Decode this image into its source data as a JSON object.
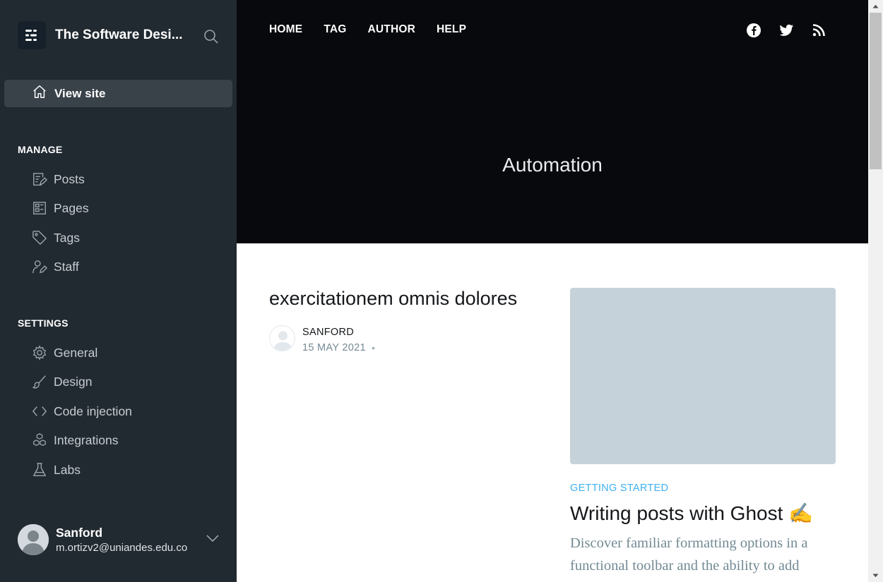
{
  "sidebar": {
    "site_title": "The Software Desi...",
    "view_site_label": "View site",
    "manage_heading": "MANAGE",
    "manage_items": [
      {
        "label": "Posts",
        "icon": "posts-icon"
      },
      {
        "label": "Pages",
        "icon": "pages-icon"
      },
      {
        "label": "Tags",
        "icon": "tag-icon"
      },
      {
        "label": "Staff",
        "icon": "staff-icon"
      }
    ],
    "settings_heading": "SETTINGS",
    "settings_items": [
      {
        "label": "General",
        "icon": "gear-icon"
      },
      {
        "label": "Design",
        "icon": "brush-icon"
      },
      {
        "label": "Code injection",
        "icon": "code-icon"
      },
      {
        "label": "Integrations",
        "icon": "integrations-icon"
      },
      {
        "label": "Labs",
        "icon": "flask-icon"
      }
    ],
    "user": {
      "name": "Sanford",
      "email": "m.ortizv2@uniandes.edu.co"
    }
  },
  "site": {
    "nav": [
      "HOME",
      "TAG",
      "AUTHOR",
      "HELP"
    ],
    "social_icons": [
      "facebook-icon",
      "twitter-icon",
      "rss-icon"
    ],
    "hero_title": "Automation"
  },
  "post": {
    "title": "exercitationem omnis dolores",
    "author": "SANFORD",
    "date": "15 MAY 2021",
    "separator": "•"
  },
  "card": {
    "tag": "GETTING STARTED",
    "title": "Writing posts with Ghost ✍️",
    "excerpt": "Discover familiar formatting options in a functional toolbar and the ability to add"
  },
  "colors": {
    "sidebar_bg": "#222a31",
    "hero_bg": "#08090c",
    "accent": "#3eb0ef",
    "image_placeholder": "#c5d2d9"
  }
}
